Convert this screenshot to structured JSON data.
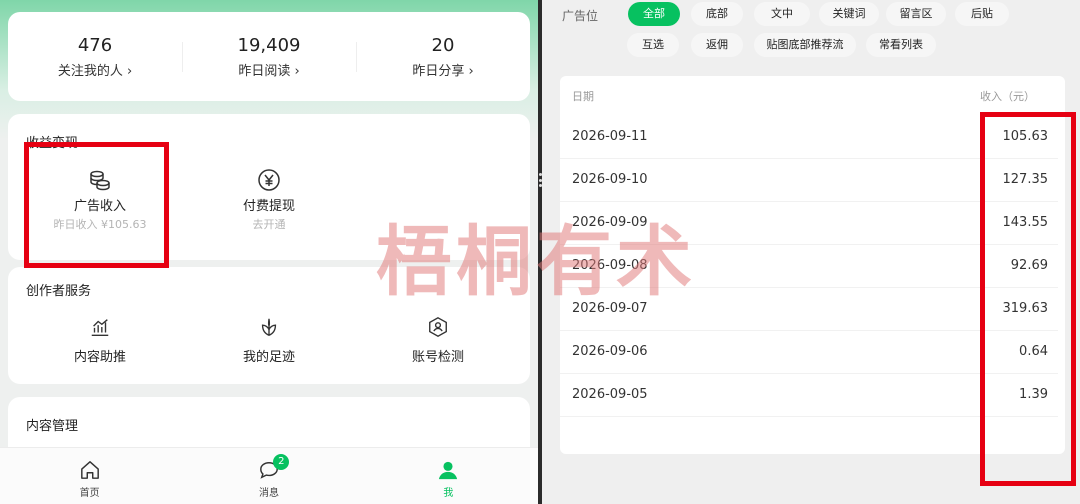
{
  "left": {
    "stats": [
      {
        "value": "476",
        "label": "关注我的人 ›"
      },
      {
        "value": "19,409",
        "label": "昨日阅读 ›"
      },
      {
        "value": "20",
        "label": "昨日分享 ›"
      }
    ],
    "monetize": {
      "title": "收益变现",
      "items": [
        {
          "icon": "coins-icon",
          "label": "广告收入",
          "sub": "昨日收入 ¥105.63"
        },
        {
          "icon": "yen-icon",
          "label": "付费提现",
          "sub": "去开通"
        }
      ]
    },
    "creator": {
      "title": "创作者服务",
      "items": [
        {
          "icon": "chart-icon",
          "label": "内容助推"
        },
        {
          "icon": "leaf-icon",
          "label": "我的足迹"
        },
        {
          "icon": "shield-user-icon",
          "label": "账号检测"
        }
      ]
    },
    "content_mgmt": {
      "title": "内容管理"
    },
    "tabbar": [
      {
        "icon": "home-icon",
        "label": "首页"
      },
      {
        "icon": "chat-icon",
        "label": "消息",
        "badge": "2"
      },
      {
        "icon": "user-icon",
        "label": "我",
        "active": true
      }
    ]
  },
  "right": {
    "filter_label": "广告位",
    "chips": [
      "全部",
      "底部",
      "文中",
      "关键词",
      "留言区",
      "后贴",
      "互选",
      "返佣",
      "贴图底部推荐流",
      "常看列表"
    ],
    "active_chip": "全部",
    "table": {
      "header_date": "日期",
      "header_income": "收入（元）",
      "rows": [
        {
          "date": "2026-09-11",
          "value": "105.63"
        },
        {
          "date": "2026-09-10",
          "value": "127.35"
        },
        {
          "date": "2026-09-09",
          "value": "143.55"
        },
        {
          "date": "2026-09-08",
          "value": "92.69"
        },
        {
          "date": "2026-09-07",
          "value": "319.63"
        },
        {
          "date": "2026-09-06",
          "value": "0.64"
        },
        {
          "date": "2026-09-05",
          "value": "1.39"
        }
      ]
    }
  },
  "watermark": "梧桐有术",
  "colors": {
    "accent": "#07c160",
    "highlight": "#e60012",
    "watermark": "#e27878"
  }
}
